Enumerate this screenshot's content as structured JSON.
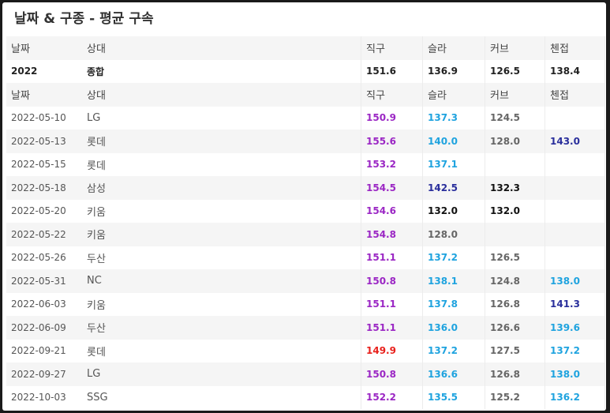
{
  "title": "날짜 & 구종 - 평균 구속",
  "colors": {
    "purple": "#9b27c4",
    "red": "#e8211c",
    "blue": "#1fa3df",
    "navy": "#2a2f9c",
    "gray": "#666666",
    "black": "#111111"
  },
  "header": {
    "date": "날짜",
    "opponent": "상대",
    "fastball": "직구",
    "slider": "슬라",
    "curve": "커브",
    "changeup": "첸접"
  },
  "summary": {
    "date": "2022",
    "opponent": "종합",
    "fastball": "151.6",
    "slider": "136.9",
    "curve": "126.5",
    "changeup": "138.4"
  },
  "rows": [
    {
      "date": "2022-05-10",
      "opponent": "LG",
      "fastball": {
        "v": "150.9",
        "c": "purple"
      },
      "slider": {
        "v": "137.3",
        "c": "blue"
      },
      "curve": {
        "v": "124.5",
        "c": "gray"
      },
      "changeup": {
        "v": "",
        "c": "gray"
      }
    },
    {
      "date": "2022-05-13",
      "opponent": "롯데",
      "fastball": {
        "v": "155.6",
        "c": "purple"
      },
      "slider": {
        "v": "140.0",
        "c": "blue"
      },
      "curve": {
        "v": "128.0",
        "c": "gray"
      },
      "changeup": {
        "v": "143.0",
        "c": "navy"
      }
    },
    {
      "date": "2022-05-15",
      "opponent": "롯데",
      "fastball": {
        "v": "153.2",
        "c": "purple"
      },
      "slider": {
        "v": "137.1",
        "c": "blue"
      },
      "curve": {
        "v": "",
        "c": "gray"
      },
      "changeup": {
        "v": "",
        "c": "gray"
      }
    },
    {
      "date": "2022-05-18",
      "opponent": "삼성",
      "fastball": {
        "v": "154.5",
        "c": "purple"
      },
      "slider": {
        "v": "142.5",
        "c": "navy"
      },
      "curve": {
        "v": "132.3",
        "c": "black"
      },
      "changeup": {
        "v": "",
        "c": "gray"
      }
    },
    {
      "date": "2022-05-20",
      "opponent": "키움",
      "fastball": {
        "v": "154.6",
        "c": "purple"
      },
      "slider": {
        "v": "132.0",
        "c": "black"
      },
      "curve": {
        "v": "132.0",
        "c": "black"
      },
      "changeup": {
        "v": "",
        "c": "gray"
      }
    },
    {
      "date": "2022-05-22",
      "opponent": "키움",
      "fastball": {
        "v": "154.8",
        "c": "purple"
      },
      "slider": {
        "v": "128.0",
        "c": "gray"
      },
      "curve": {
        "v": "",
        "c": "gray"
      },
      "changeup": {
        "v": "",
        "c": "gray"
      }
    },
    {
      "date": "2022-05-26",
      "opponent": "두산",
      "fastball": {
        "v": "151.1",
        "c": "purple"
      },
      "slider": {
        "v": "137.2",
        "c": "blue"
      },
      "curve": {
        "v": "126.5",
        "c": "gray"
      },
      "changeup": {
        "v": "",
        "c": "gray"
      }
    },
    {
      "date": "2022-05-31",
      "opponent": "NC",
      "fastball": {
        "v": "150.8",
        "c": "purple"
      },
      "slider": {
        "v": "138.1",
        "c": "blue"
      },
      "curve": {
        "v": "124.8",
        "c": "gray"
      },
      "changeup": {
        "v": "138.0",
        "c": "blue"
      }
    },
    {
      "date": "2022-06-03",
      "opponent": "키움",
      "fastball": {
        "v": "151.1",
        "c": "purple"
      },
      "slider": {
        "v": "137.8",
        "c": "blue"
      },
      "curve": {
        "v": "126.8",
        "c": "gray"
      },
      "changeup": {
        "v": "141.3",
        "c": "navy"
      }
    },
    {
      "date": "2022-06-09",
      "opponent": "두산",
      "fastball": {
        "v": "151.1",
        "c": "purple"
      },
      "slider": {
        "v": "136.0",
        "c": "blue"
      },
      "curve": {
        "v": "126.6",
        "c": "gray"
      },
      "changeup": {
        "v": "139.6",
        "c": "blue"
      }
    },
    {
      "date": "2022-09-21",
      "opponent": "롯데",
      "fastball": {
        "v": "149.9",
        "c": "red"
      },
      "slider": {
        "v": "137.2",
        "c": "blue"
      },
      "curve": {
        "v": "127.5",
        "c": "gray"
      },
      "changeup": {
        "v": "137.2",
        "c": "blue"
      }
    },
    {
      "date": "2022-09-27",
      "opponent": "LG",
      "fastball": {
        "v": "150.8",
        "c": "purple"
      },
      "slider": {
        "v": "136.6",
        "c": "blue"
      },
      "curve": {
        "v": "126.8",
        "c": "gray"
      },
      "changeup": {
        "v": "138.0",
        "c": "blue"
      }
    },
    {
      "date": "2022-10-03",
      "opponent": "SSG",
      "fastball": {
        "v": "152.2",
        "c": "purple"
      },
      "slider": {
        "v": "135.5",
        "c": "blue"
      },
      "curve": {
        "v": "125.2",
        "c": "gray"
      },
      "changeup": {
        "v": "136.2",
        "c": "blue"
      }
    }
  ]
}
